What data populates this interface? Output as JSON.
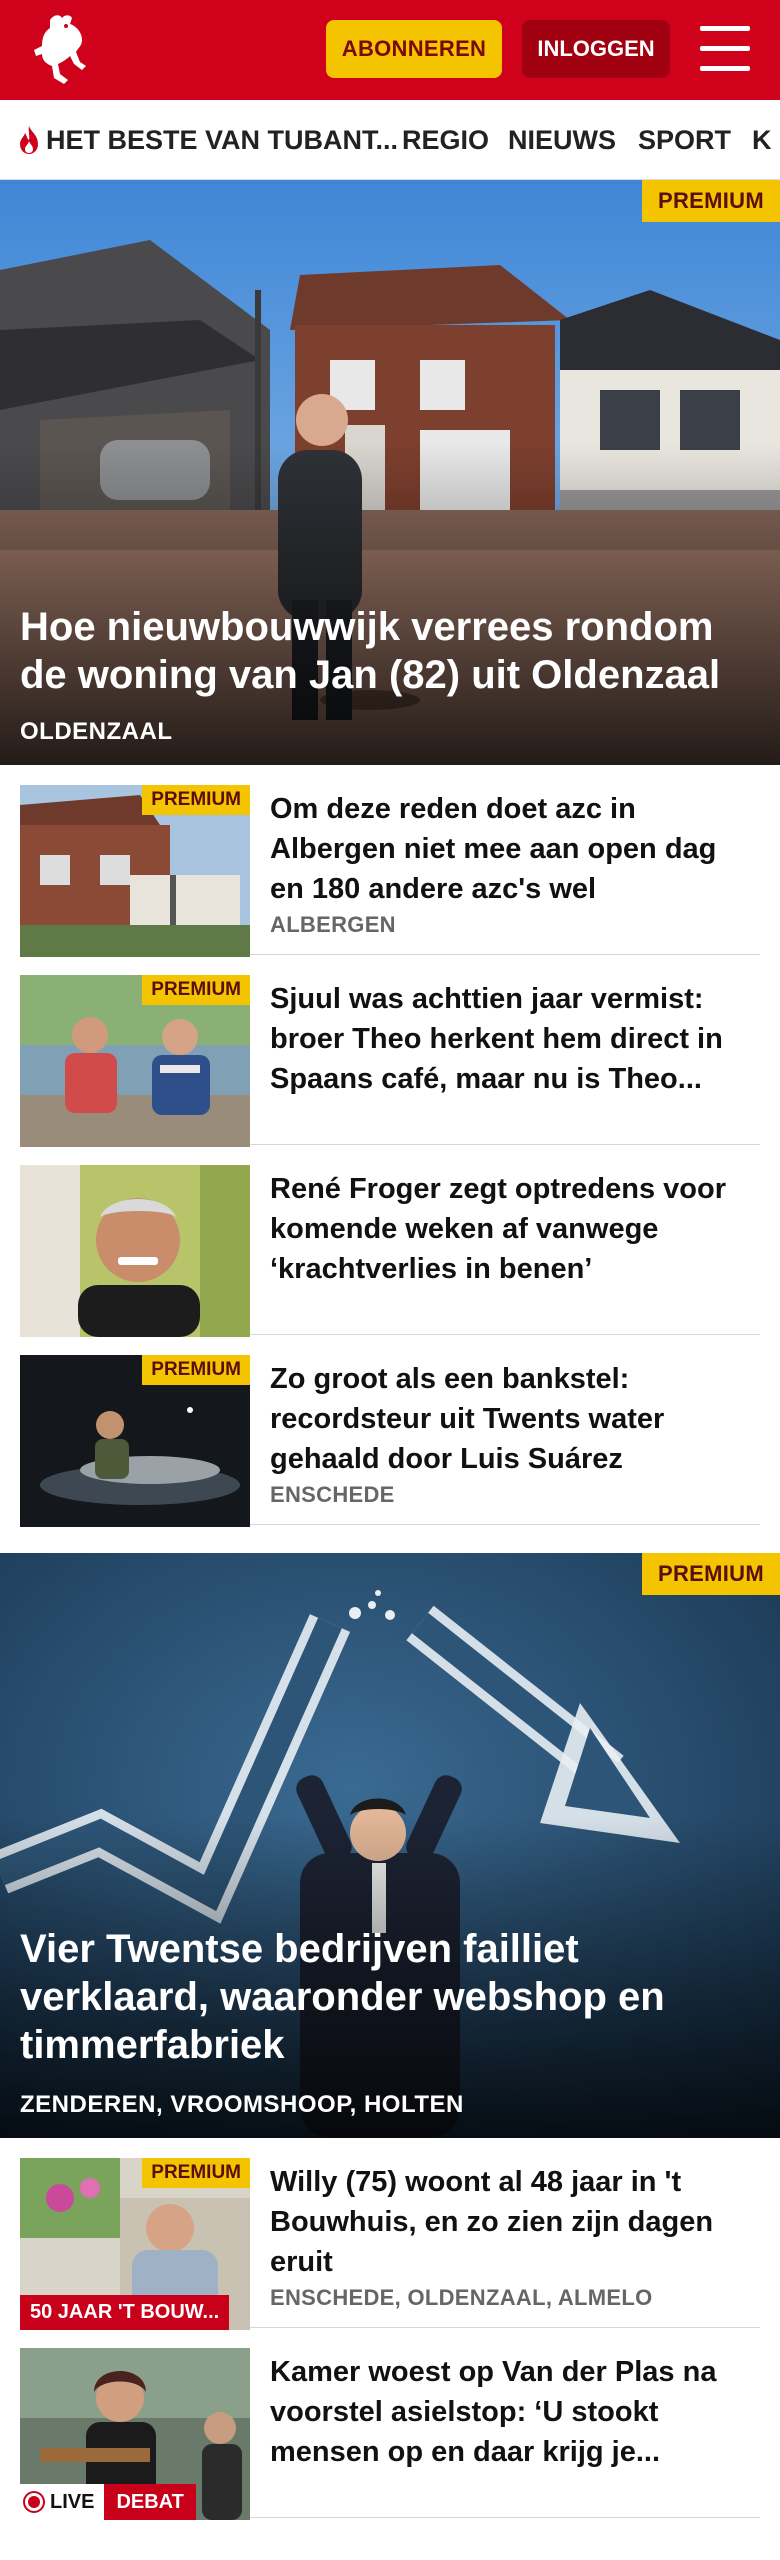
{
  "header": {
    "subscribe_label": "ABONNEREN",
    "login_label": "INLOGGEN",
    "brand_color": "#d0021b",
    "accent_color": "#f5c400"
  },
  "nav": {
    "items": [
      "HET BESTE VAN TUBANT...",
      "REGIO",
      "NIEUWS",
      "SPORT",
      "K"
    ]
  },
  "premium_label": "PREMIUM",
  "hero1": {
    "title": "Hoe nieuwbouwwijk verrees rondom de woning van Jan (82) uit Oldenzaal",
    "location": "OLDENZAAL",
    "premium": true
  },
  "articles1": [
    {
      "title": "Om deze reden doet azc in Albergen niet mee aan open dag en 180 andere azc's wel",
      "location": "ALBERGEN",
      "premium": true
    },
    {
      "title": "Sjuul was achttien jaar vermist: broer Theo herkent hem direct in Spaans café, maar nu is Theo...",
      "location": "",
      "premium": true
    },
    {
      "title": "René Froger zegt optredens voor komende weken af vanwege ‘krachtverlies in benen’",
      "location": "",
      "premium": false
    },
    {
      "title": "Zo groot als een bankstel: recordsteur uit Twents water gehaald door Luis Suárez",
      "location": "ENSCHEDE",
      "premium": true
    }
  ],
  "hero2": {
    "title": "Vier Twentse bedrijven failliet verklaard, waaronder webshop en timmerfabriek",
    "location": "ZENDEREN, VROOMSHOOP, HOLTEN",
    "premium": true
  },
  "articles2": [
    {
      "title": "Willy (75) woont al 48 jaar in 't Bouwhuis, en zo zien zijn dagen eruit",
      "location": "ENSCHEDE, OLDENZAAL, ALMELO",
      "premium": true,
      "label": "50 JAAR 'T BOUW..."
    },
    {
      "title": "Kamer woest op Van der Plas na voorstel asielstop: ‘U stookt mensen op en daar krijg je...",
      "location": "",
      "premium": false,
      "live_label": "LIVE",
      "tag_label": "DEBAT"
    }
  ]
}
